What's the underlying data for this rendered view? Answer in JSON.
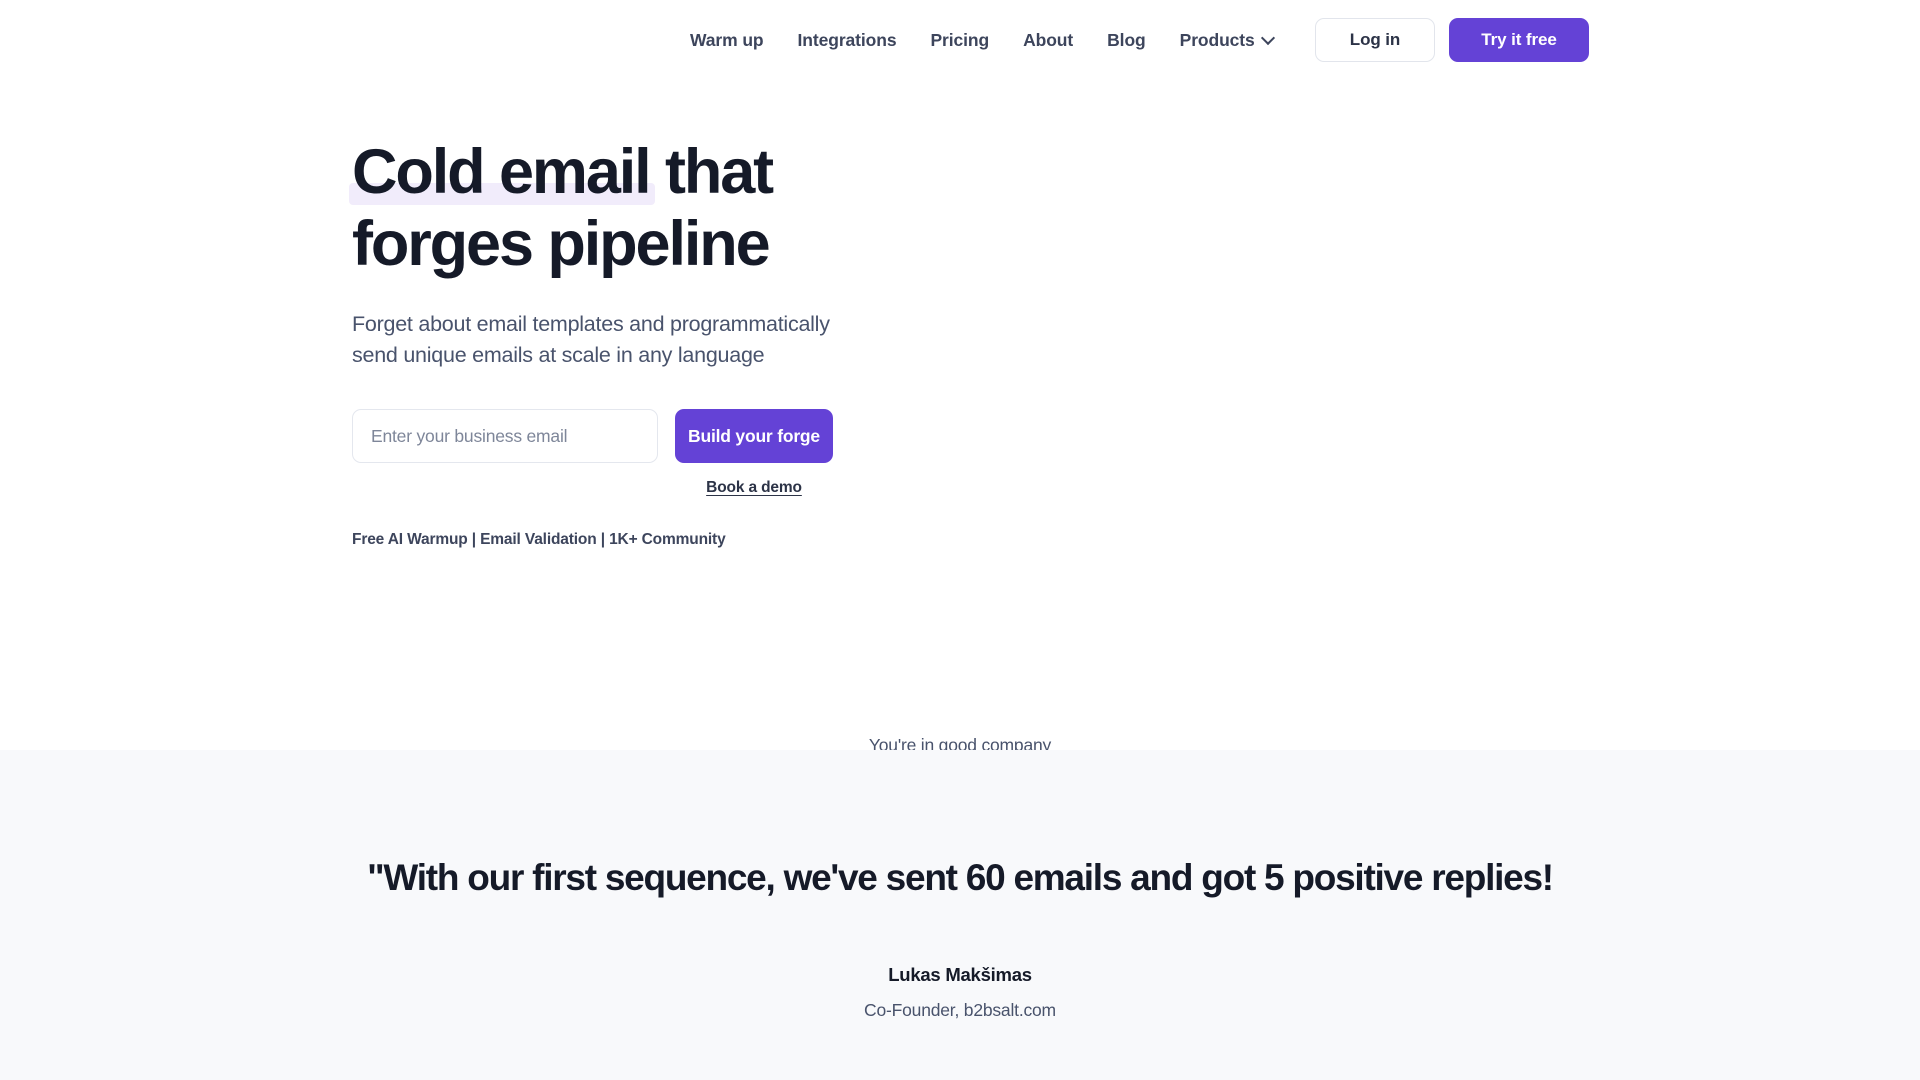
{
  "header": {
    "nav_links": [
      {
        "label": "Warm up"
      },
      {
        "label": "Integrations"
      },
      {
        "label": "Pricing"
      },
      {
        "label": "About"
      },
      {
        "label": "Blog"
      }
    ],
    "products": {
      "label": "Products",
      "icon": "chevron-down-icon"
    },
    "login_label": "Log in",
    "try_free_label": "Try it free"
  },
  "hero": {
    "title_line1_highlight": "Cold email",
    "title_line1_rest": " that",
    "title_line2": "forges pipeline",
    "subtitle": "Forget about email templates and programmatically send unique emails at scale in any language",
    "email_placeholder": "Enter your business email",
    "email_value": "",
    "cta_label": "Build your forge",
    "demo_link_label": "Book a demo",
    "features_line": "Free AI Warmup | Email Validation | 1K+ Community",
    "good_company_label": "You're in good company"
  },
  "testimonial": {
    "quote": "\"With our first sequence, we've sent 60 emails and got 5 positive replies!",
    "author_name": "Lukas Makšimas",
    "author_role": "Co-Founder, b2bsalt.com"
  },
  "colors": {
    "accent_purple": "#6442d6",
    "highlight_lavender": "#f1ecfb",
    "heading_navy": "#151a28",
    "body_slate": "#49536c",
    "section_bg": "#f8f9fb"
  }
}
